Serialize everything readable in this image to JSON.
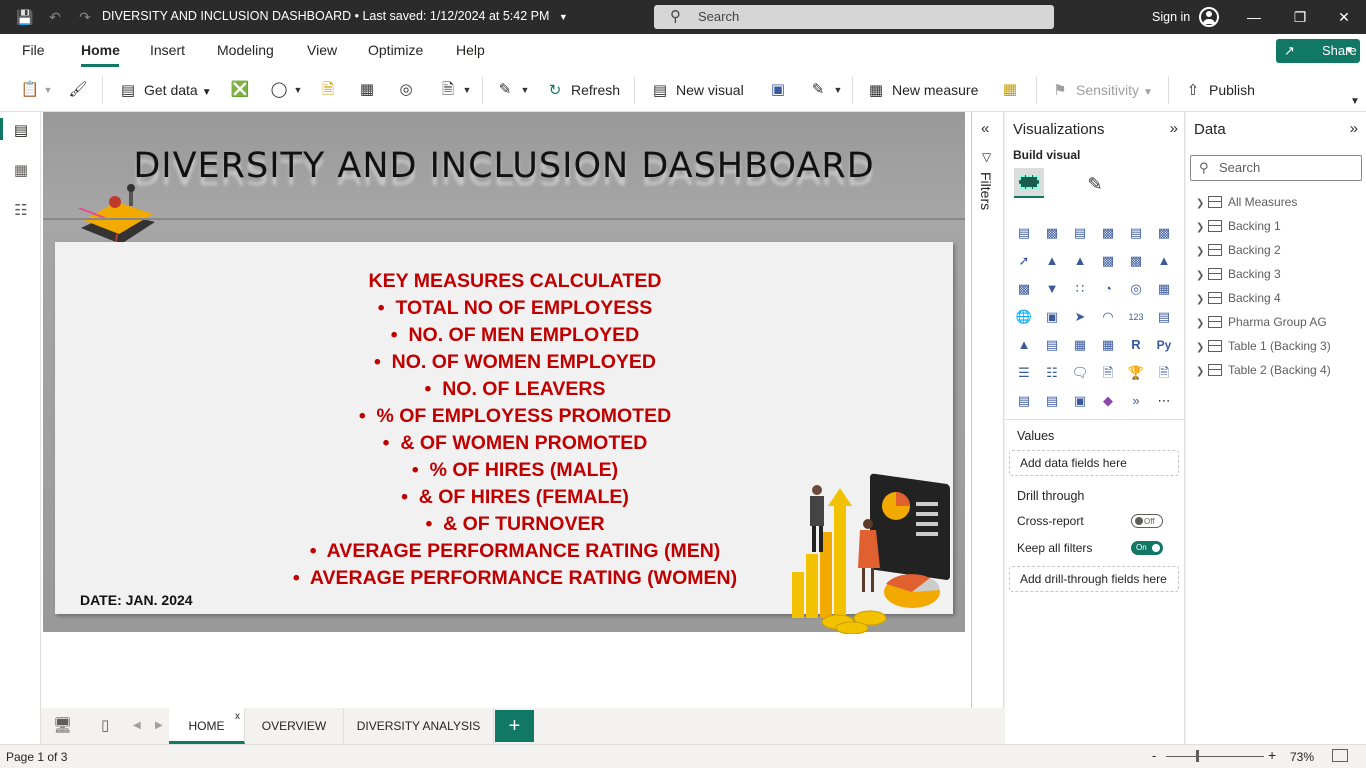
{
  "titlebar": {
    "title": "DIVERSITY AND INCLUSION DASHBOARD",
    "saved": " • Last saved: 1/12/2024 at 5:42 PM",
    "search_placeholder": "Search",
    "sign_in": "Sign in"
  },
  "menu": {
    "items": [
      "File",
      "Home",
      "Insert",
      "Modeling",
      "View",
      "Optimize",
      "Help"
    ],
    "share": "Share"
  },
  "ribbon": {
    "get_data": "Get data",
    "refresh": "Refresh",
    "new_visual": "New visual",
    "new_measure": "New measure",
    "sensitivity": "Sensitivity",
    "publish": "Publish"
  },
  "report": {
    "title": "DIVERSITY AND INCLUSION DASHBOARD",
    "measures_heading": "KEY MEASURES CALCULATED",
    "measures": [
      "TOTAL NO OF EMPLOYESS",
      "NO. OF MEN EMPLOYED",
      "NO. OF WOMEN EMPLOYED",
      "NO. OF LEAVERS",
      "% OF EMPLOYESS PROMOTED",
      "& OF WOMEN PROMOTED",
      "% OF HIRES (MALE)",
      "& OF HIRES (FEMALE)",
      "& OF TURNOVER",
      "AVERAGE PERFORMANCE RATING (MEN)",
      "AVERAGE PERFORMANCE RATING (WOMEN)"
    ],
    "date": "DATE: JAN. 2024"
  },
  "filters": {
    "label": "Filters"
  },
  "visualizations": {
    "title": "Visualizations",
    "build_visual": "Build visual",
    "values_label": "Values",
    "values_drop": "Add data fields here",
    "drill_through": "Drill through",
    "cross_report": "Cross-report",
    "cross_report_state": "Off",
    "keep_filters": "Keep all filters",
    "keep_filters_state": "On",
    "drill_drop": "Add drill-through fields here"
  },
  "data_pane": {
    "title": "Data",
    "search_placeholder": "Search",
    "items": [
      "All Measures",
      "Backing 1",
      "Backing 2",
      "Backing 3",
      "Backing 4",
      "Pharma Group AG",
      "Table 1 (Backing 3)",
      "Table 2 (Backing 4)"
    ]
  },
  "pages": {
    "tabs": [
      "HOME",
      "OVERVIEW",
      "DIVERSITY ANALYSIS"
    ],
    "active": "HOME",
    "close": "x",
    "add": "+"
  },
  "status": {
    "page": "Page 1 of 3",
    "zoom": "73%",
    "zoom_level": 0.73
  },
  "colors": {
    "accent": "#117865",
    "measure_text": "#c00000",
    "titlebar": "#2b2b2b"
  }
}
